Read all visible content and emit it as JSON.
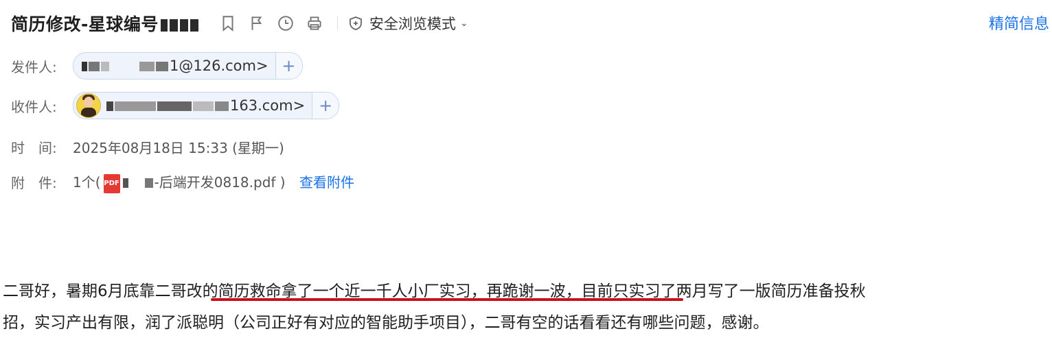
{
  "header": {
    "subject": "简历修改-星球编号",
    "safe_mode_label": "安全浏览模式",
    "brief_info_label": "精简信息",
    "icons": [
      "bookmark-icon",
      "flag-icon",
      "clock-icon",
      "print-icon",
      "shield-icon",
      "chevron-down-icon"
    ]
  },
  "fields": {
    "from_label": "发件人:",
    "from_value": "1@126.com>",
    "to_label": "收件人:",
    "to_value": "163.com>",
    "time_label": "时　间:",
    "time_value": "2025年08月18日 15:33 (星期一)",
    "attach_label": "附　件:",
    "attach_prefix": "1个(",
    "attach_name": "-后端开发0818.pdf",
    "attach_suffix": ")",
    "attach_link": "查看附件",
    "pdf_badge": "PDF",
    "plus": "+"
  },
  "body": {
    "line1": "二哥好，暑期6月底靠二哥改的简历救命拿了一个近一千人小厂实习，再跪谢一波，目前只实习了两月写了一版简历准备投秋",
    "line2": "招，实习产出有限，润了派聪明（公司正好有对应的智能助手项目），二哥有空的话看看还有哪些问题，感谢。"
  },
  "colors": {
    "link": "#1a73e8",
    "underline": "#c9101a",
    "chip_bg": "#eef3fc"
  }
}
